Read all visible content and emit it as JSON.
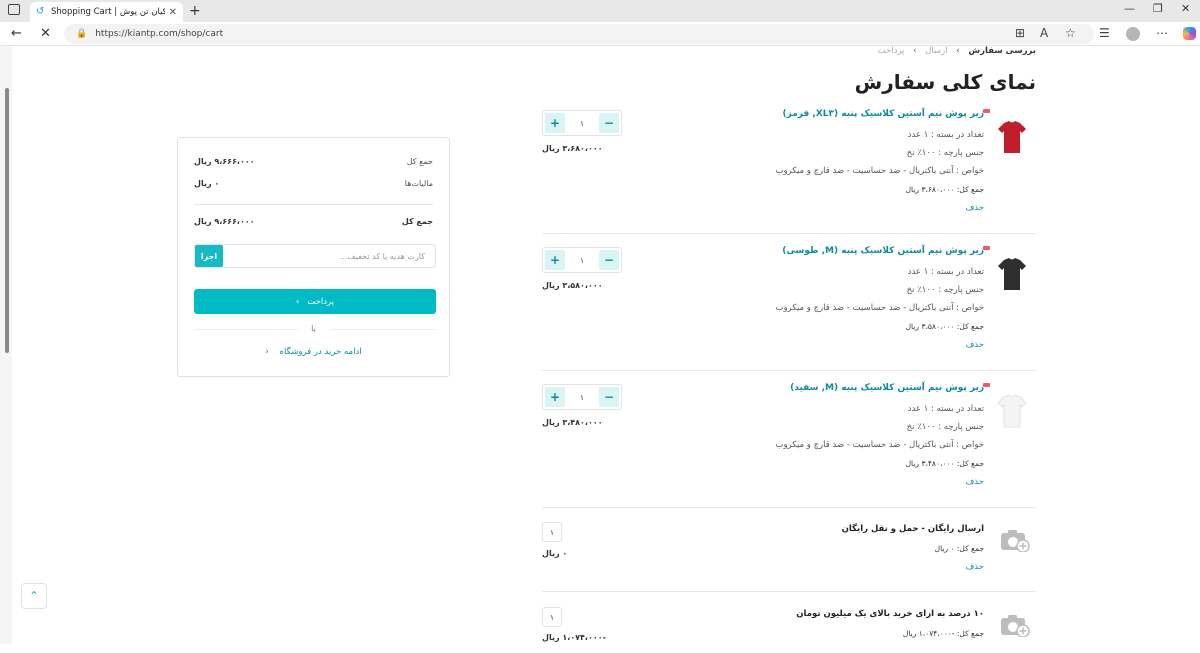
{
  "browser": {
    "tab_title": "Shopping Cart | کیان تن پوش",
    "url": "https://kiantp.com/shop/cart",
    "new_tab_symbol": "+",
    "close_symbol": "✕"
  },
  "breadcrumb": {
    "current": "بررسی سفارش",
    "step2": "ارسال",
    "step3": "پرداخت"
  },
  "page_title": "نمای کلی سفارش",
  "cart_items": [
    {
      "title": "زیر پوش نیم آستین کلاسیک پنبه (XL۳, قرمز)",
      "pack": "تعداد در بسته : ۱ عدد",
      "fabric": "جنس پارچه : ۱۰۰٪ نخ",
      "features": "خواص : آنتی باکتریال - ضد حساسیت - ضد قارچ و میکروب",
      "total": "جمع کل: ۳،۶۸۰،۰۰۰ ریال",
      "delete": "حذف",
      "qty": "۱",
      "price": "۳،۶۸۰،۰۰۰ ریال",
      "color": "#c01e2e"
    },
    {
      "title": "زیر پوش نیم آستین کلاسیک پنبه (M, طوسی)",
      "pack": "تعداد در بسته : ۱ عدد",
      "fabric": "جنس پارچه : ۱۰۰٪ نخ",
      "features": "خواص : آنتی باکتریال - ضد حساسیت - ضد قارچ و میکروب",
      "total": "جمع کل: ۳،۵۸۰،۰۰۰ ریال",
      "delete": "حذف",
      "qty": "۱",
      "price": "۳،۵۸۰،۰۰۰ ریال",
      "color": "#2d2f31"
    },
    {
      "title": "زیر پوش نیم آستین کلاسیک پنبه (M, سفید)",
      "pack": "تعداد در بسته : ۱ عدد",
      "fabric": "جنس پارچه : ۱۰۰٪ نخ",
      "features": "خواص : آنتی باکتریال - ضد حساسیت - ضد قارچ و میکروب",
      "total": "جمع کل: ۳،۴۸۰،۰۰۰ ریال",
      "delete": "حذف",
      "qty": "۱",
      "price": "۳،۴۸۰،۰۰۰ ریال",
      "color": "#f4f4f4"
    }
  ],
  "services": [
    {
      "title": "ارسال رایگان - حمل و نقل رایگان",
      "total": "جمع کل: ۰ ریال",
      "delete": "حذف",
      "qty": "۱",
      "price": "۰ ریال"
    },
    {
      "title": "۱۰ درصد به ازای خرید بالای یک میلیون تومان",
      "total": "جمع کل: -۱،۰۷۴،۰۰۰ ریال",
      "qty": "۱",
      "price": "-۱،۰۷۴،۰۰۰ ریال"
    }
  ],
  "summary": {
    "subtotal_label": "جمع کل",
    "subtotal_value": "۹،۶۶۶،۰۰۰ ریال",
    "tax_label": "مالیات‌ها",
    "tax_value": "۰ ریال",
    "total_label": "جمع کل",
    "total_value": "۹،۶۶۶،۰۰۰ ریال",
    "coupon_placeholder": "کارت هدیه یا کد تخفیف...",
    "apply_label": "اجرا",
    "pay_label": "پرداخت",
    "or_label": "یا",
    "continue_label": "ادامه خرید در فروشگاه"
  },
  "colors": {
    "accent": "#00bac5",
    "link": "#0f8c9c"
  }
}
